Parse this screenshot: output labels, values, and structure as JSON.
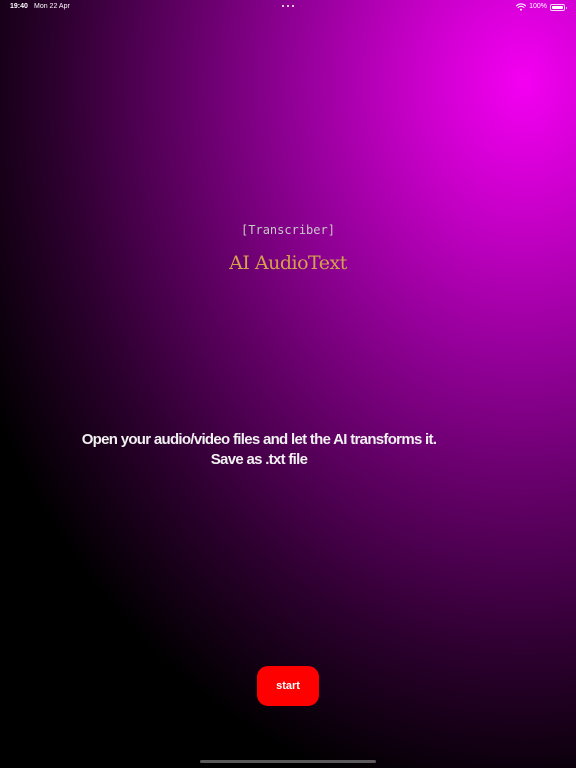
{
  "status_bar": {
    "time": "19:40",
    "date": "Mon 22 Apr",
    "battery": "100%",
    "icons": [
      "more-dots-icon",
      "wifi-icon",
      "battery-icon"
    ]
  },
  "header": {
    "tag": "[Transcriber]",
    "title": "AI AudioText"
  },
  "main": {
    "description_line_1": "Open your audio/video files and let the AI transforms it.",
    "description_line_2": "Save as .txt file"
  },
  "actions": {
    "start_label": "start"
  },
  "colors": {
    "accent": "#ff0000",
    "title": "#d4a24c",
    "gradient_top_right": "#f400f2",
    "background_dark": "#000000"
  }
}
